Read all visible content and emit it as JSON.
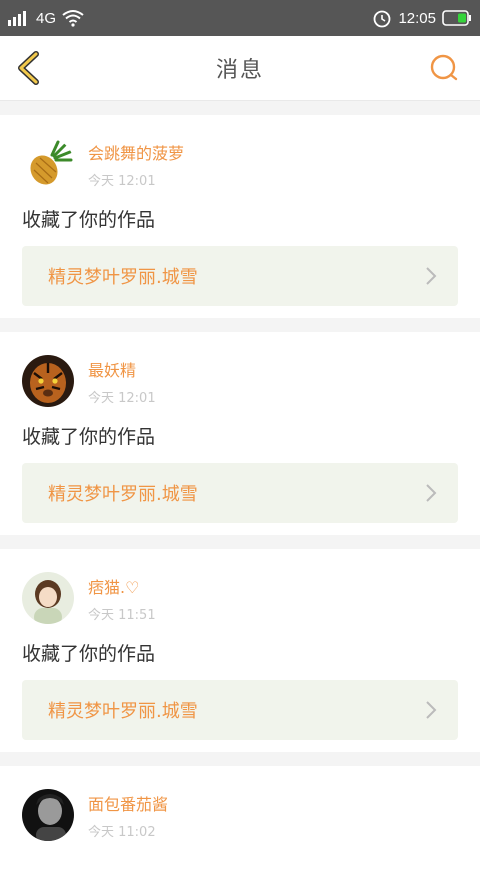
{
  "status": {
    "signal": "4G",
    "time": "12:05"
  },
  "nav": {
    "title": "消息"
  },
  "messages": [
    {
      "name": "会跳舞的菠萝",
      "time": "今天 12:01",
      "action": "收藏了你的作品",
      "work": "精灵梦叶罗丽.城雪",
      "avatar": "pineapple"
    },
    {
      "name": "最妖精",
      "time": "今天 12:01",
      "action": "收藏了你的作品",
      "work": "精灵梦叶罗丽.城雪",
      "avatar": "tiger"
    },
    {
      "name": "痞猫.♡",
      "time": "今天 11:51",
      "action": "收藏了你的作品",
      "work": "精灵梦叶罗丽.城雪",
      "avatar": "girl"
    },
    {
      "name": "面包番茄酱",
      "time": "今天 11:02",
      "avatar": "person-bw"
    }
  ],
  "colors": {
    "accent": "#f09545",
    "back_icon": "#f2c94c"
  }
}
